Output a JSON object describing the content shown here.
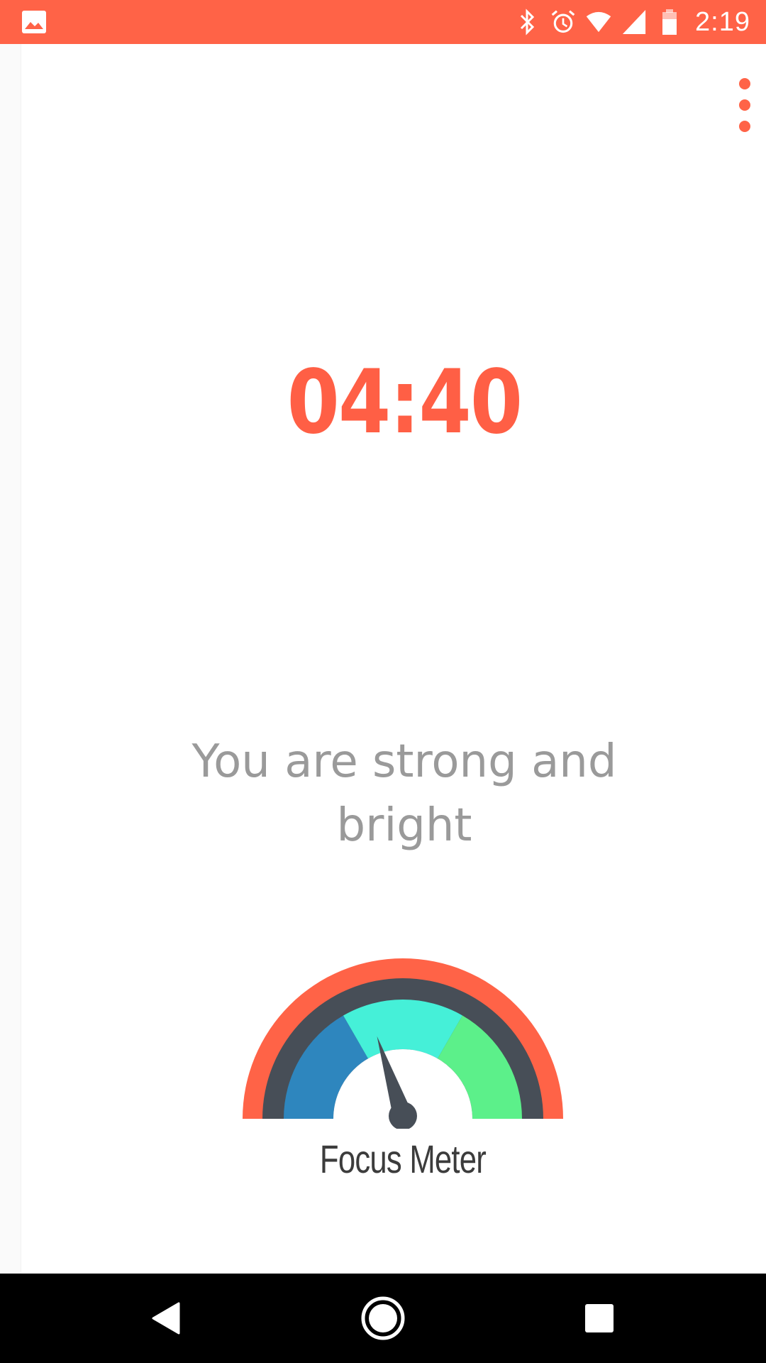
{
  "status_bar": {
    "time": "2:19",
    "icons": [
      "image-notification-icon",
      "bluetooth-icon",
      "alarm-icon",
      "wifi-icon",
      "signal-icon",
      "battery-icon"
    ],
    "background": "#ff6347"
  },
  "toolbar": {
    "menu_icon": "more-vert-icon"
  },
  "timer": {
    "value": "04:40",
    "color": "#ff5f45"
  },
  "message": {
    "text": "You are strong and bright"
  },
  "focus_meter": {
    "label": "Focus Meter",
    "level": 0.4,
    "zones": [
      "#2e86be",
      "#45f0d8",
      "#5cf08a"
    ],
    "outer_ring": "#ff6347",
    "inner_ring": "#474e57"
  },
  "nav_bar": {
    "buttons": [
      "back-icon",
      "home-icon",
      "recents-icon"
    ]
  }
}
